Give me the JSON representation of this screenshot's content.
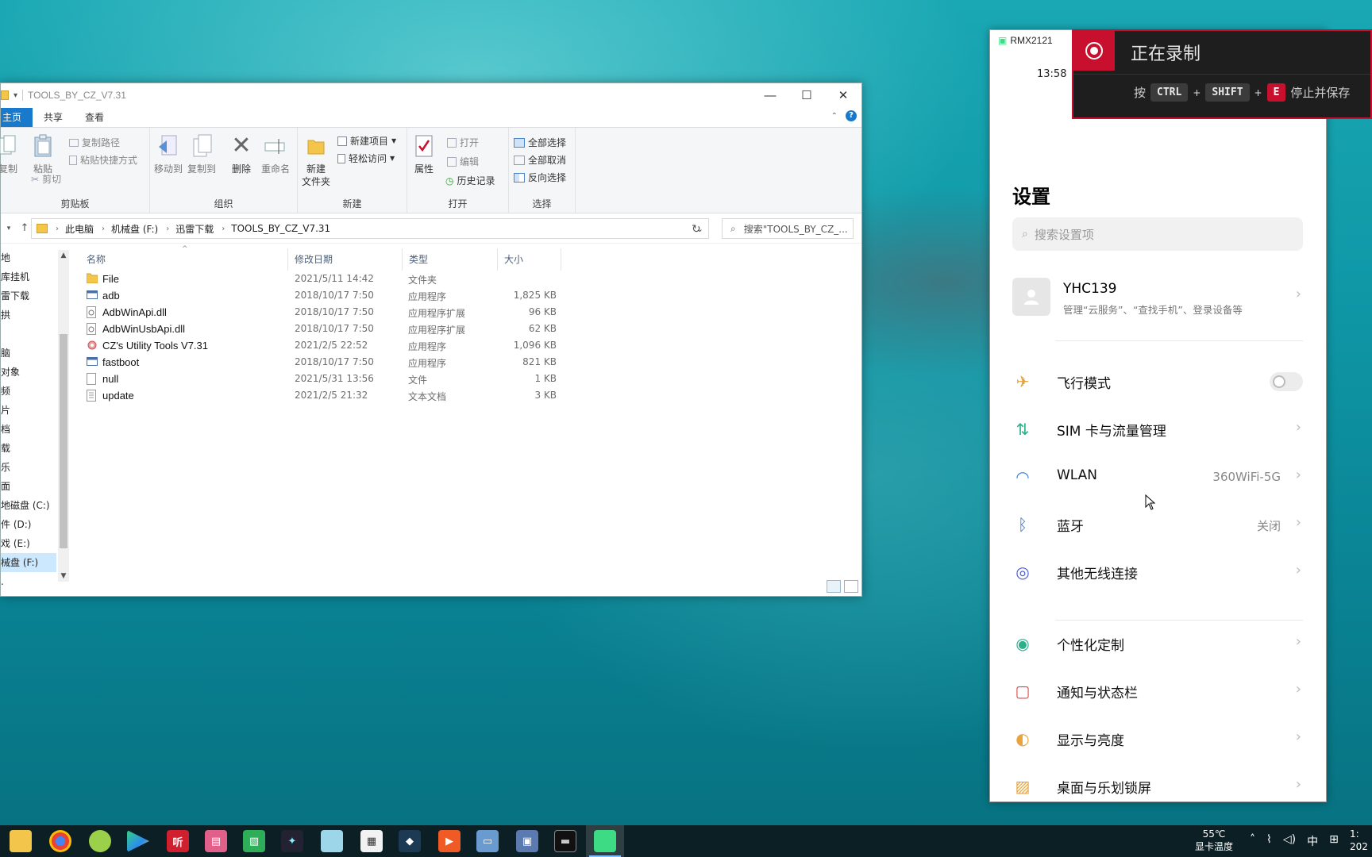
{
  "explorer": {
    "title": "TOOLS_BY_CZ_V7.31",
    "tabs": [
      "主页",
      "共享",
      "查看"
    ],
    "ribbon": {
      "clipboard": {
        "copy": "复制",
        "paste": "粘贴",
        "copy_path": "复制路径",
        "paste_shortcut": "粘贴快捷方式",
        "cut": "剪切",
        "label": "剪贴板"
      },
      "organize": {
        "move_to": "移动到",
        "copy_to": "复制到",
        "delete": "删除",
        "rename": "重命名",
        "label": "组织"
      },
      "new": {
        "new_folder_line1": "新建",
        "new_folder_line2": "文件夹",
        "new_item": "新建项目",
        "easy_access": "轻松访问",
        "label": "新建"
      },
      "open": {
        "properties": "属性",
        "open": "打开",
        "edit": "编辑",
        "history": "历史记录",
        "label": "打开"
      },
      "select": {
        "select_all": "全部选择",
        "select_none": "全部取消",
        "invert": "反向选择",
        "label": "选择"
      }
    },
    "breadcrumb": [
      "此电脑",
      "机械盘 (F:)",
      "迅雷下载",
      "TOOLS_BY_CZ_V7.31"
    ],
    "search_placeholder": "搜索\"TOOLS_BY_CZ_...",
    "nav_items": [
      "地",
      "库挂机",
      "雷下载",
      "拱",
      "",
      "脑",
      "对象",
      "频",
      "片",
      "档",
      "载",
      "乐",
      "面",
      "地磁盘 (C:)",
      "件 (D:)",
      "戏 (E:)",
      "械盘 (F:)",
      "."
    ],
    "columns": {
      "name": "名称",
      "date": "修改日期",
      "type": "类型",
      "size": "大小"
    },
    "files": [
      {
        "name": "File",
        "date": "2021/5/11 14:42",
        "type": "文件夹",
        "size": "",
        "icon": "folder-icon"
      },
      {
        "name": "adb",
        "date": "2018/10/17 7:50",
        "type": "应用程序",
        "size": "1,825 KB",
        "icon": "exe-icon"
      },
      {
        "name": "AdbWinApi.dll",
        "date": "2018/10/17 7:50",
        "type": "应用程序扩展",
        "size": "96 KB",
        "icon": "dll-icon"
      },
      {
        "name": "AdbWinUsbApi.dll",
        "date": "2018/10/17 7:50",
        "type": "应用程序扩展",
        "size": "62 KB",
        "icon": "dll-icon"
      },
      {
        "name": "CZ's Utility Tools V7.31",
        "date": "2021/2/5 22:52",
        "type": "应用程序",
        "size": "1,096 KB",
        "icon": "gear-app-icon"
      },
      {
        "name": "fastboot",
        "date": "2018/10/17 7:50",
        "type": "应用程序",
        "size": "821 KB",
        "icon": "exe-icon"
      },
      {
        "name": "null",
        "date": "2021/5/31 13:56",
        "type": "文件",
        "size": "1 KB",
        "icon": "file-icon"
      },
      {
        "name": "update",
        "date": "2021/2/5 21:32",
        "type": "文本文档",
        "size": "3 KB",
        "icon": "text-file-icon"
      }
    ]
  },
  "phone": {
    "device": "RMX2121",
    "time": "13:58",
    "heading": "设置",
    "search_placeholder": "搜索设置项",
    "account": {
      "name": "YHC139",
      "subtitle": "管理“云服务”、“查找手机”、登录设备等"
    },
    "rows": [
      {
        "label": "飞行模式",
        "value": "",
        "toggle": true,
        "icon": "airplane-icon",
        "color": "#e8a33a"
      },
      {
        "label": "SIM 卡与流量管理",
        "value": "",
        "icon": "sim-data-icon",
        "color": "#2bb08a"
      },
      {
        "label": "WLAN",
        "value": "360WiFi-5G",
        "icon": "wifi-icon",
        "color": "#3a7bd5"
      },
      {
        "label": "蓝牙",
        "value": "关闭",
        "icon": "bluetooth-icon",
        "color": "#3a7bd5"
      },
      {
        "label": "其他无线连接",
        "value": "",
        "icon": "wireless-connections-icon",
        "color": "#4a5ad8"
      },
      {
        "label": "个性化定制",
        "value": "",
        "icon": "palette-icon",
        "color": "#2bb08a"
      },
      {
        "label": "通知与状态栏",
        "value": "",
        "icon": "notification-icon",
        "color": "#d84a4a"
      },
      {
        "label": "显示与亮度",
        "value": "",
        "icon": "brightness-icon",
        "color": "#e8a33a"
      },
      {
        "label": "桌面与乐划锁屏",
        "value": "",
        "icon": "wallpaper-icon",
        "color": "#e8a33a"
      }
    ]
  },
  "recording": {
    "title": "正在录制",
    "press": "按",
    "keys": [
      "CTRL",
      "SHIFT",
      "E"
    ],
    "plus": "+",
    "action": "停止并保存"
  },
  "taskbar": {
    "temp_value": "55℃",
    "temp_label": "显卡温度",
    "ime": "中",
    "clock_line1": "1:",
    "clock_line2": "202"
  },
  "colors": {
    "accent": "#1979ca",
    "recording_red": "#c8102e",
    "taskbar": "#0c1f24"
  }
}
